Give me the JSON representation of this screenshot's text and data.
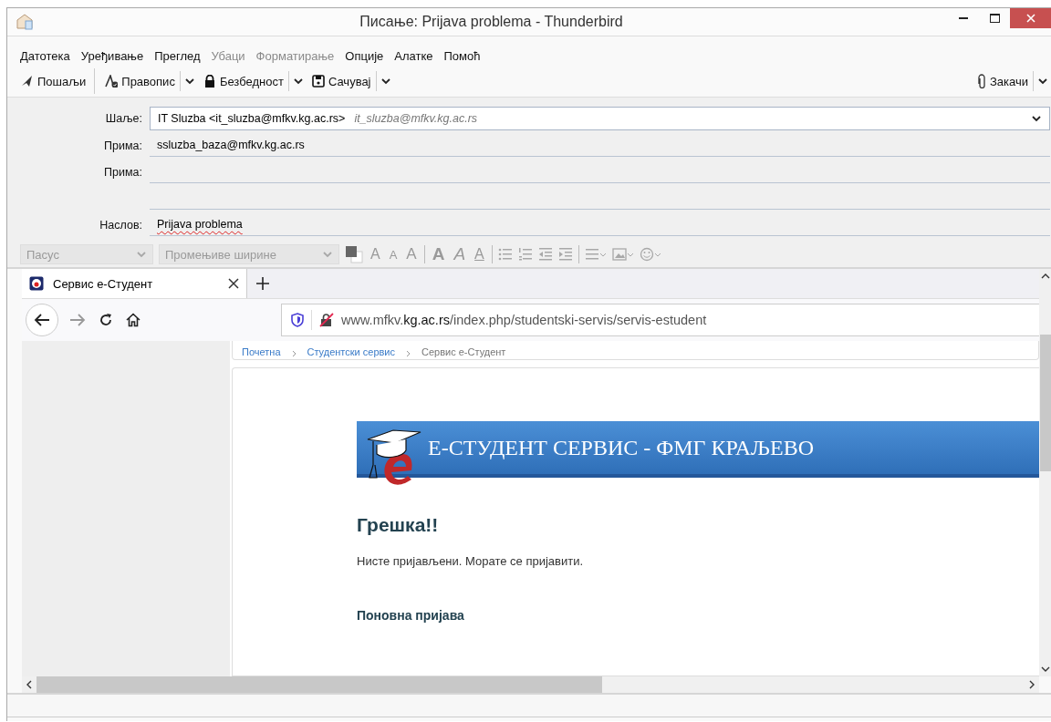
{
  "window": {
    "title": "Писање: Prijava problema - Thunderbird"
  },
  "menu": [
    {
      "label": "Датотека",
      "disabled": false
    },
    {
      "label": "Уређивање",
      "disabled": false
    },
    {
      "label": "Преглед",
      "disabled": false
    },
    {
      "label": "Убаци",
      "disabled": true
    },
    {
      "label": "Форматирање",
      "disabled": true
    },
    {
      "label": "Опције",
      "disabled": false
    },
    {
      "label": "Алатке",
      "disabled": false
    },
    {
      "label": "Помоћ",
      "disabled": false
    }
  ],
  "toolbar": {
    "buttons": [
      {
        "kind": "send",
        "label": "Пошаљи",
        "dropdown": false
      },
      {
        "kind": "spelling",
        "label": "Правопис",
        "dropdown": true
      },
      {
        "kind": "security",
        "label": "Безбедност",
        "dropdown": true
      },
      {
        "kind": "save",
        "label": "Сачувај",
        "dropdown": true
      }
    ],
    "attach": {
      "label": "Закачи"
    }
  },
  "header": {
    "from": {
      "label": "Шаље:",
      "value": "IT Sluzba <it_sluzba@mfkv.kg.ac.rs>",
      "identity": "it_sluzba@mfkv.kg.ac.rs"
    },
    "recipients": [
      {
        "label": "Прима:",
        "value": "ssluzba_baza@mfkv.kg.ac.rs"
      },
      {
        "label": "Прима:"
      }
    ],
    "subject": {
      "label": "Наслов:",
      "value": "Prijava problema"
    }
  },
  "format_bar": {
    "disabled": true,
    "paragraph": "Пасус",
    "font": "Промењиве ширине",
    "tools": [
      {
        "kind": "plain",
        "glyph": "A"
      },
      {
        "kind": "small",
        "glyph": "A"
      },
      {
        "kind": "big",
        "glyph": "A"
      },
      {
        "kind": "bold",
        "glyph": "A"
      },
      {
        "kind": "italic",
        "glyph": "A"
      },
      {
        "kind": "underline",
        "glyph": "A"
      }
    ]
  },
  "browser": {
    "tab": {
      "title": "Сервис е-Студент",
      "selected": true
    },
    "url": {
      "prefix": "www.mfkv.",
      "domain": "kg.ac.rs",
      "path": "/index.php/studentski-servis/servis-estudent"
    },
    "breadcrumb": [
      "Почетна",
      "Студентски сервис",
      "Сервис е-Студент"
    ],
    "page": {
      "banner": "Е-СТУДЕНТ СЕРВИС - ФМГ КРАЉЕВО",
      "heading": "Грешка!!",
      "message": "Нисте пријављени. Морате се пријавити.",
      "link": "Поновна пријава"
    }
  }
}
